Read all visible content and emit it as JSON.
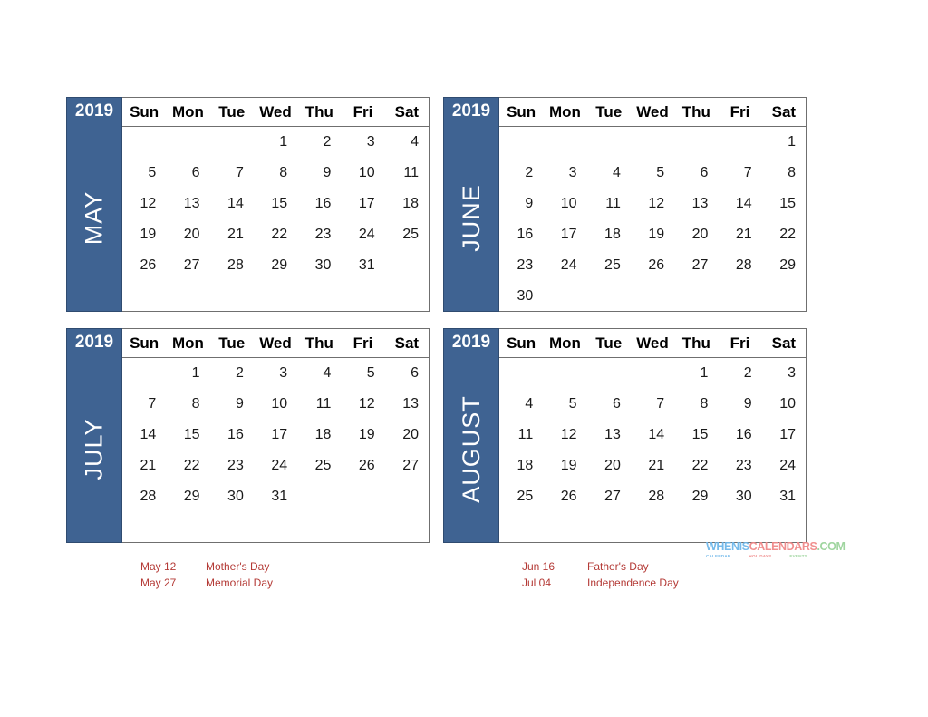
{
  "page": {
    "background": "#ffffff",
    "accent_blue": "#3F6392",
    "holiday_red": "#B43A36"
  },
  "weekday_headers": [
    "Sun",
    "Mon",
    "Tue",
    "Wed",
    "Thu",
    "Fri",
    "Sat"
  ],
  "calendars": [
    {
      "year": "2019",
      "month": "MAY",
      "weeks": [
        [
          "",
          "",
          "",
          "1",
          "2",
          "3",
          "4"
        ],
        [
          "5",
          "6",
          "7",
          "8",
          "9",
          "10",
          "11"
        ],
        [
          "12",
          "13",
          "14",
          "15",
          "16",
          "17",
          "18"
        ],
        [
          "19",
          "20",
          "21",
          "22",
          "23",
          "24",
          "25"
        ],
        [
          "26",
          "27",
          "28",
          "29",
          "30",
          "31",
          ""
        ],
        [
          "",
          "",
          "",
          "",
          "",
          "",
          ""
        ]
      ]
    },
    {
      "year": "2019",
      "month": "JUNE",
      "weeks": [
        [
          "",
          "",
          "",
          "",
          "",
          "",
          "1"
        ],
        [
          "2",
          "3",
          "4",
          "5",
          "6",
          "7",
          "8"
        ],
        [
          "9",
          "10",
          "11",
          "12",
          "13",
          "14",
          "15"
        ],
        [
          "16",
          "17",
          "18",
          "19",
          "20",
          "21",
          "22"
        ],
        [
          "23",
          "24",
          "25",
          "26",
          "27",
          "28",
          "29"
        ],
        [
          "30",
          "",
          "",
          "",
          "",
          "",
          ""
        ]
      ]
    },
    {
      "year": "2019",
      "month": "JULY",
      "weeks": [
        [
          "",
          "1",
          "2",
          "3",
          "4",
          "5",
          "6"
        ],
        [
          "7",
          "8",
          "9",
          "10",
          "11",
          "12",
          "13"
        ],
        [
          "14",
          "15",
          "16",
          "17",
          "18",
          "19",
          "20"
        ],
        [
          "21",
          "22",
          "23",
          "24",
          "25",
          "26",
          "27"
        ],
        [
          "28",
          "29",
          "30",
          "31",
          "",
          "",
          ""
        ],
        [
          "",
          "",
          "",
          "",
          "",
          "",
          ""
        ]
      ]
    },
    {
      "year": "2019",
      "month": "AUGUST",
      "weeks": [
        [
          "",
          "",
          "",
          "",
          "1",
          "2",
          "3"
        ],
        [
          "4",
          "5",
          "6",
          "7",
          "8",
          "9",
          "10"
        ],
        [
          "11",
          "12",
          "13",
          "14",
          "15",
          "16",
          "17"
        ],
        [
          "18",
          "19",
          "20",
          "21",
          "22",
          "23",
          "24"
        ],
        [
          "25",
          "26",
          "27",
          "28",
          "29",
          "30",
          "31"
        ],
        [
          "",
          "",
          "",
          "",
          "",
          "",
          ""
        ]
      ]
    }
  ],
  "holidays_left": [
    {
      "date": "May 12",
      "name": "Mother's Day"
    },
    {
      "date": "May 27",
      "name": "Memorial Day"
    }
  ],
  "holidays_right": [
    {
      "date": "Jun 16",
      "name": "Father's Day"
    },
    {
      "date": "Jul 04",
      "name": "Independence Day"
    }
  ],
  "watermark": {
    "part1": "WHENIS",
    "part2": "CALENDARS",
    "part3": ".COM",
    "sub1": "CALENDAR",
    "sub2": "HOLIDAYS",
    "sub3": "EVENTS"
  }
}
